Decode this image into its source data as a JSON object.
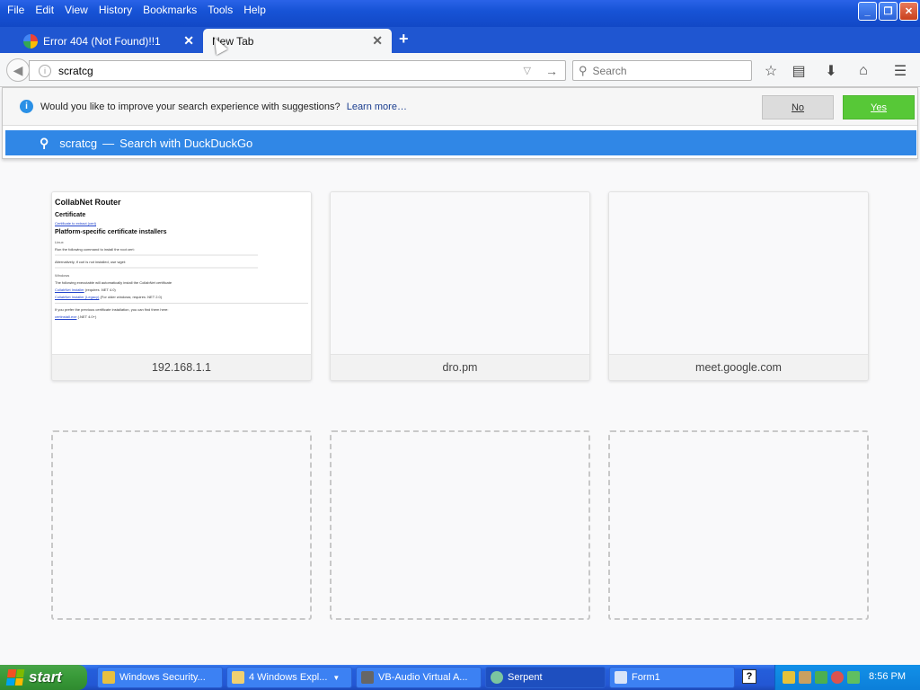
{
  "menu": {
    "items": [
      "File",
      "Edit",
      "View",
      "History",
      "Bookmarks",
      "Tools",
      "Help"
    ]
  },
  "tabs": [
    {
      "title": "Error 404 (Not Found)!!1",
      "active": false
    },
    {
      "title": "New Tab",
      "active": true
    }
  ],
  "toolbar": {
    "url_value": "scratcg",
    "search_placeholder": "Search"
  },
  "suggestion_prompt": {
    "message": "Would you like to improve your search experience with suggestions?",
    "learn_more": "Learn more…",
    "no_label": "No",
    "yes_label": "Yes"
  },
  "search_suggestion": {
    "query": "scratcg",
    "dash": "—",
    "action": "Search with DuckDuckGo"
  },
  "tiles": [
    {
      "label": "192.168.1.1"
    },
    {
      "label": "dro.pm"
    },
    {
      "label": "meet.google.com"
    }
  ],
  "thumbnail_doc": {
    "title": "CollabNet Router",
    "h_certificate": "Certificate",
    "link_cert": "Certificate to extract (cert)",
    "h_platform": "Platform-specific certificate installers",
    "linux": "Linux",
    "linux_text": "Run the following command to install the root cert:",
    "alt_text": "Alternatively, if curl is not installed, use wget:",
    "windows": "Windows",
    "win_text": "The following executable will automatically install the CollabNet certificate",
    "link_installer": "CollabNet Installer",
    "link_installer_note": "(requires .NET 4.0)",
    "link_installer2": "CollabNet Installer (Legacy)",
    "link_installer2_note": "(For older windows; requires .NET 2.0)",
    "prev_text": "If you prefer the previous certificate installation, you can find them here:",
    "link_prev": "certinstall.exe",
    "link_prev_note": "(.NET 4.0+)"
  },
  "taskbar": {
    "start_label": "start",
    "items": [
      {
        "label": "Windows Security..."
      },
      {
        "label": "4  Windows Expl..."
      },
      {
        "label": "VB-Audio Virtual A..."
      },
      {
        "label": "Serpent"
      },
      {
        "label": "Form1"
      }
    ],
    "help_glyph": "?",
    "clock": "8:56 PM"
  },
  "colors": {
    "title_blue": "#1753d6",
    "suggestion_blue": "#3087e6",
    "yes_green": "#57c837",
    "start_green": "#3a9c3a",
    "tray_blue": "#0c7fd9"
  }
}
